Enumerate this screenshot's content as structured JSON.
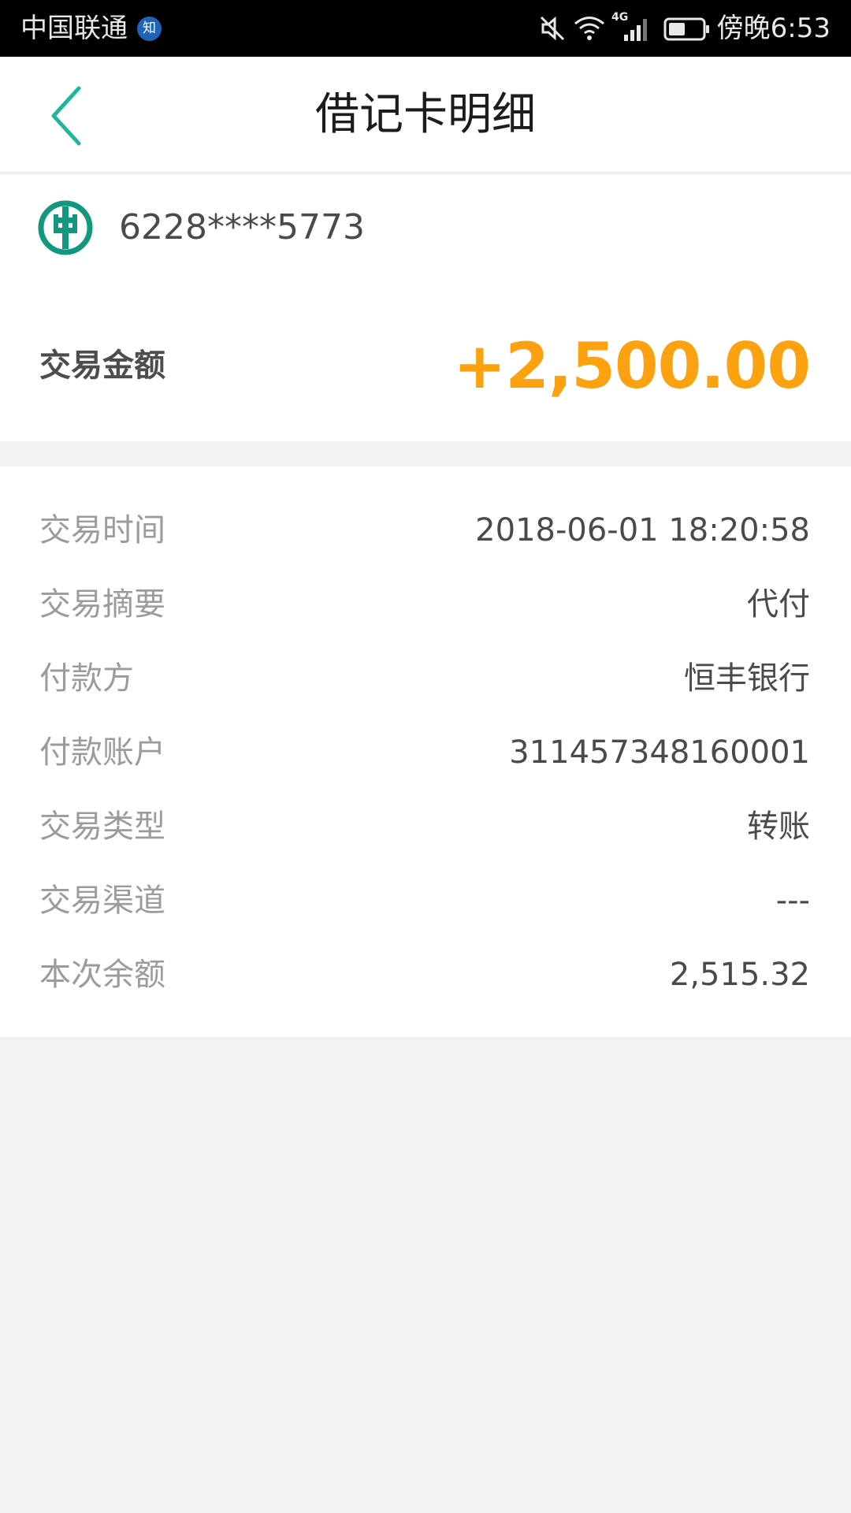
{
  "status_bar": {
    "carrier": "中国联通",
    "carrier_badge": "知",
    "time": "傍晚6:53",
    "network_label": "4G",
    "icons": [
      "mute-icon",
      "wifi-icon",
      "signal-icon",
      "battery-icon"
    ]
  },
  "nav": {
    "title": "借记卡明细",
    "back_icon": "chevron-left-icon"
  },
  "card": {
    "bank_logo": "abc-bank-logo",
    "number": "6228****5773"
  },
  "transaction": {
    "amount_label": "交易金额",
    "amount_value": "+2,500.00"
  },
  "details": [
    {
      "label": "交易时间",
      "value": "2018-06-01 18:20:58"
    },
    {
      "label": "交易摘要",
      "value": "代付"
    },
    {
      "label": "付款方",
      "value": "恒丰银行"
    },
    {
      "label": "付款账户",
      "value": "311457348160001"
    },
    {
      "label": "交易类型",
      "value": "转账"
    },
    {
      "label": "交易渠道",
      "value": "---"
    },
    {
      "label": "本次余额",
      "value": "2,515.32"
    }
  ],
  "colors": {
    "accent": "#1fb59f",
    "amount": "#fca10f",
    "logo": "#13987f",
    "page_background": "#f4f1f4"
  }
}
